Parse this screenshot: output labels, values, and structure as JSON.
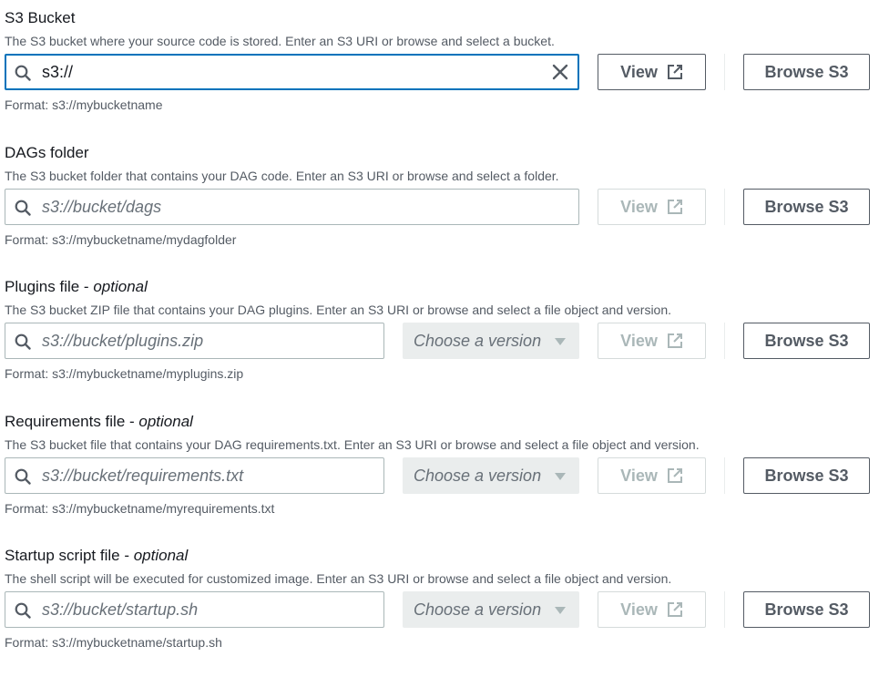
{
  "colors": {
    "focus": "#0073bb",
    "border": "#aab7b8",
    "text_secondary": "#545b64",
    "disabled": "#aab7b8",
    "select_bg": "#eaeded"
  },
  "fields": [
    {
      "label": "S3 Bucket",
      "optional": "",
      "description": "The S3 bucket where your source code is stored. Enter an S3 URI or browse and select a bucket.",
      "input_value": "s3://",
      "placeholder": "",
      "has_version": false,
      "version_placeholder": "",
      "view_label": "View",
      "browse_label": "Browse S3",
      "format": "Format: s3://mybucketname"
    },
    {
      "label": "DAGs folder",
      "optional": "",
      "description": "The S3 bucket folder that contains your DAG code. Enter an S3 URI or browse and select a folder.",
      "input_value": "",
      "placeholder": "s3://bucket/dags",
      "has_version": false,
      "version_placeholder": "",
      "view_label": "View",
      "browse_label": "Browse S3",
      "format": "Format: s3://mybucketname/mydagfolder"
    },
    {
      "label": "Plugins file - ",
      "optional": "optional",
      "description": "The S3 bucket ZIP file that contains your DAG plugins. Enter an S3 URI or browse and select a file object and version.",
      "input_value": "",
      "placeholder": "s3://bucket/plugins.zip",
      "has_version": true,
      "version_placeholder": "Choose a version",
      "view_label": "View",
      "browse_label": "Browse S3",
      "format": "Format: s3://mybucketname/myplugins.zip"
    },
    {
      "label": "Requirements file - ",
      "optional": "optional",
      "description": "The S3 bucket file that contains your DAG requirements.txt. Enter an S3 URI or browse and select a file object and version.",
      "input_value": "",
      "placeholder": "s3://bucket/requirements.txt",
      "has_version": true,
      "version_placeholder": "Choose a version",
      "view_label": "View",
      "browse_label": "Browse S3",
      "format": "Format: s3://mybucketname/myrequirements.txt"
    },
    {
      "label": "Startup script file - ",
      "optional": "optional",
      "description": "The shell script will be executed for customized image. Enter an S3 URI or browse and select a file object and version.",
      "input_value": "",
      "placeholder": "s3://bucket/startup.sh",
      "has_version": true,
      "version_placeholder": "Choose a version",
      "view_label": "View",
      "browse_label": "Browse S3",
      "format": "Format: s3://mybucketname/startup.sh"
    }
  ]
}
